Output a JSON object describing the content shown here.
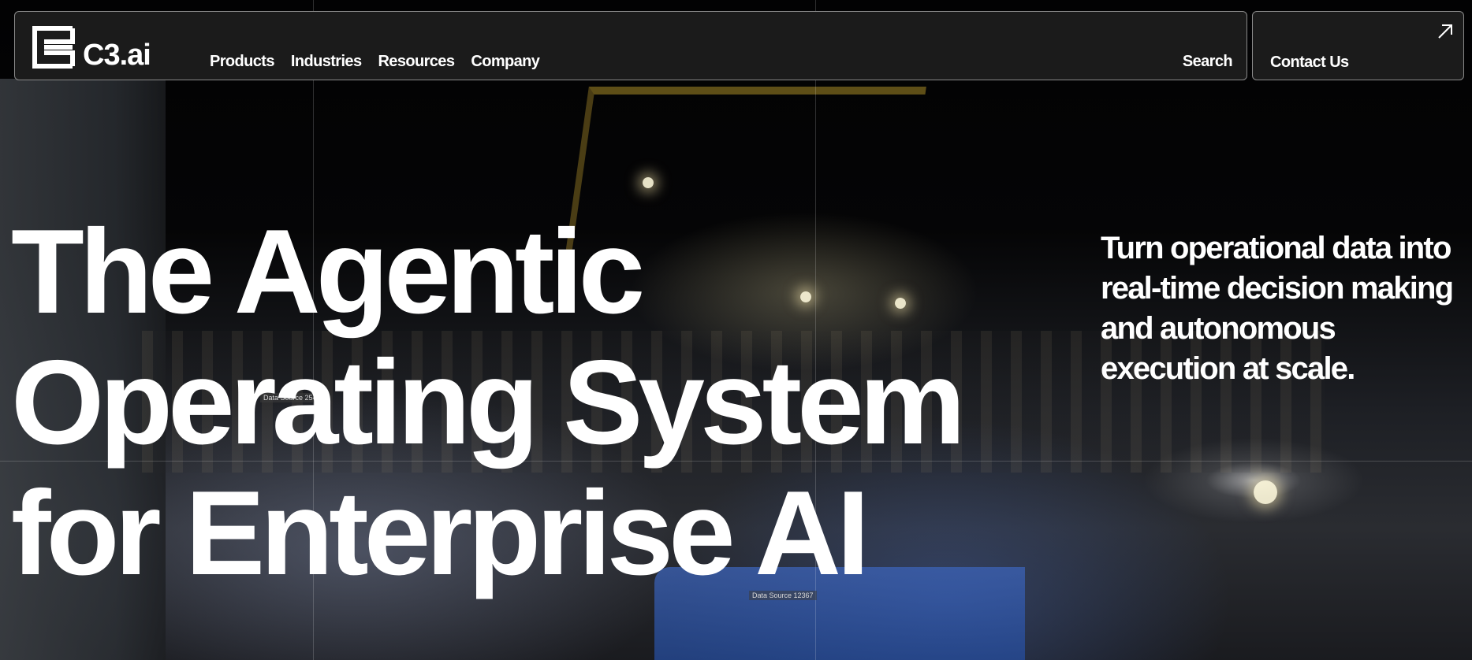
{
  "brand": {
    "name": "C3.ai",
    "logo_icon": "c3-logo-icon"
  },
  "nav": {
    "items": [
      {
        "label": "Products"
      },
      {
        "label": "Industries"
      },
      {
        "label": "Resources"
      },
      {
        "label": "Company"
      }
    ],
    "search_label": "Search"
  },
  "contact": {
    "label": "Contact Us",
    "icon": "arrow-up-right-icon"
  },
  "hero": {
    "title_lines": [
      "The Agentic",
      "Operating System",
      "for Enterprise AI"
    ],
    "subtitle": "Turn operational data into real-time decision making and autonomous execution at scale."
  },
  "background_tags": [
    "Data Source 25458",
    "Data Source 12367"
  ],
  "colors": {
    "nav_bg": "#1b1b1b",
    "nav_border": "#8a8a8a",
    "text": "#ffffff"
  }
}
